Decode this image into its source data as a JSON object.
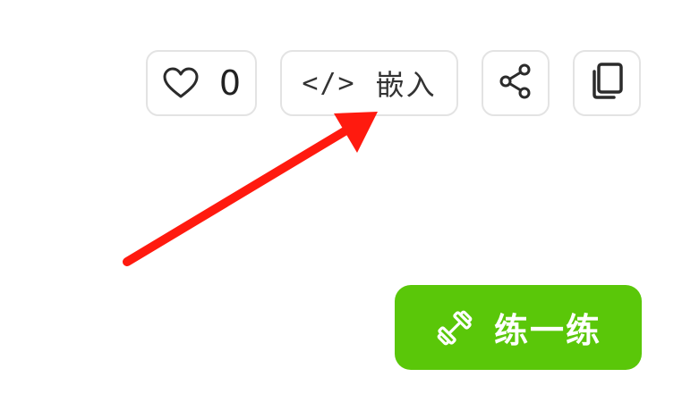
{
  "toolbar": {
    "like": {
      "icon": "heart-icon",
      "count": "0"
    },
    "embed": {
      "code_glyph": "</>",
      "label": "嵌入",
      "icon": "code-icon"
    },
    "share": {
      "icon": "share-icon"
    },
    "copy": {
      "icon": "copy-icon"
    }
  },
  "practice_button": {
    "label": "练一练",
    "icon": "dumbbell-icon",
    "color": "#5ac709"
  },
  "annotation": {
    "type": "arrow",
    "color": "#ff1a0f"
  }
}
